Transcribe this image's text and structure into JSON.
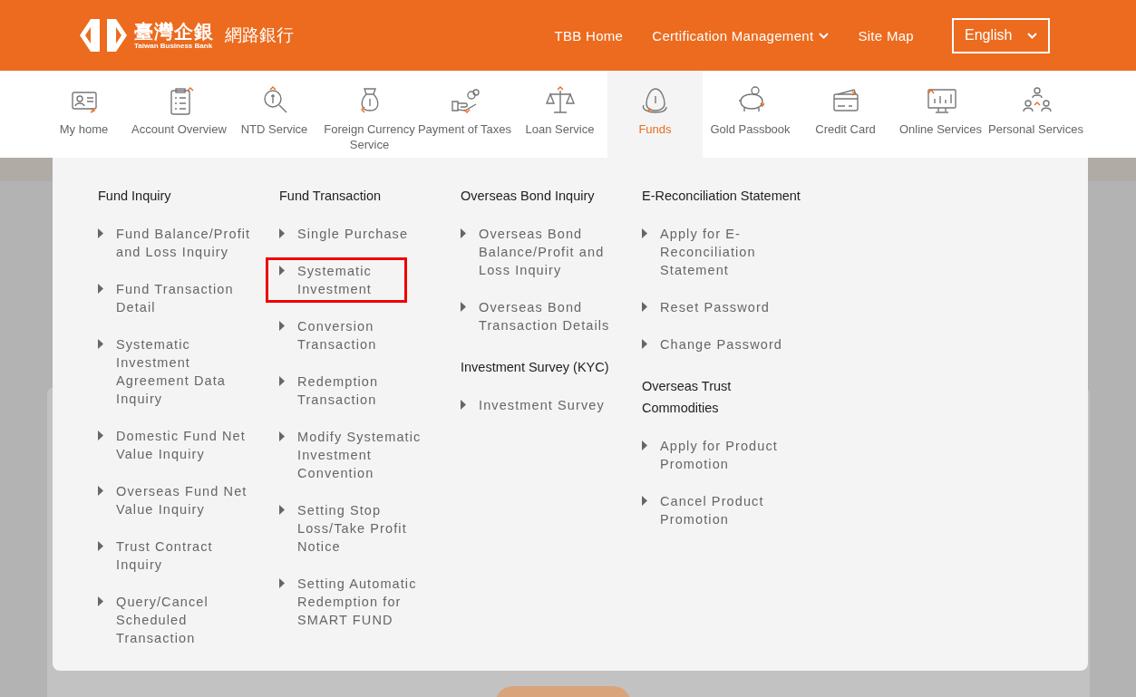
{
  "header": {
    "logo_name": "臺灣企銀",
    "logo_subtitle": "Taiwan Business Bank",
    "site_title": "網路銀行",
    "links": [
      {
        "label": "TBB Home",
        "dropdown": false
      },
      {
        "label": "Certification Management",
        "dropdown": true
      },
      {
        "label": "Site Map",
        "dropdown": false
      }
    ],
    "language": "English"
  },
  "nav": [
    {
      "label": "My home",
      "selected": false
    },
    {
      "label": "Account Overview",
      "selected": false
    },
    {
      "label": "NTD Service",
      "selected": false
    },
    {
      "label": "Foreign Currency Service",
      "selected": false
    },
    {
      "label": "Payment of Taxes",
      "selected": false
    },
    {
      "label": "Loan Service",
      "selected": false
    },
    {
      "label": "Funds",
      "selected": true
    },
    {
      "label": "Gold Passbook",
      "selected": false
    },
    {
      "label": "Credit Card",
      "selected": false
    },
    {
      "label": "Online Services",
      "selected": false
    },
    {
      "label": "Personal Services",
      "selected": false
    }
  ],
  "menu": {
    "columns": [
      {
        "groups": [
          {
            "heading": "Fund Inquiry",
            "items": [
              {
                "label": "Fund Balance/Profit and Loss Inquiry",
                "selected": false
              },
              {
                "label": "Fund Transaction Detail",
                "selected": false
              },
              {
                "label": "Systematic Investment Agreement Data Inquiry",
                "selected": false
              },
              {
                "label": "Domestic Fund Net Value Inquiry",
                "selected": false
              },
              {
                "label": "Overseas Fund Net Value Inquiry",
                "selected": false
              },
              {
                "label": "Trust Contract Inquiry",
                "selected": false
              },
              {
                "label": "Query/Cancel Scheduled Transaction",
                "selected": false
              }
            ]
          }
        ]
      },
      {
        "groups": [
          {
            "heading": "Fund Transaction",
            "items": [
              {
                "label": "Single Purchase",
                "selected": false
              },
              {
                "label": "Systematic Investment",
                "selected": true
              },
              {
                "label": "Conversion Transaction",
                "selected": false
              },
              {
                "label": "Redemption Transaction",
                "selected": false
              },
              {
                "label": "Modify Systematic Investment Convention",
                "selected": false
              },
              {
                "label": "Setting Stop Loss/Take Profit Notice",
                "selected": false
              },
              {
                "label": "Setting Automatic Redemption for SMART FUND",
                "selected": false
              }
            ]
          }
        ]
      },
      {
        "groups": [
          {
            "heading": "Overseas Bond Inquiry",
            "items": [
              {
                "label": "Overseas Bond Balance/Profit and Loss Inquiry",
                "selected": false
              },
              {
                "label": "Overseas Bond Transaction Details",
                "selected": false
              }
            ]
          },
          {
            "heading": "Investment Survey (KYC)",
            "items": [
              {
                "label": "Investment Survey",
                "selected": false
              }
            ]
          }
        ]
      },
      {
        "groups": [
          {
            "heading": "E-Reconciliation Statement",
            "items": [
              {
                "label": "Apply for E-Reconciliation Statement",
                "selected": false
              },
              {
                "label": "Reset Password",
                "selected": false
              },
              {
                "label": "Change Password",
                "selected": false
              }
            ]
          },
          {
            "heading": "Overseas Trust Commodities",
            "items": [
              {
                "label": "Apply for Product Promotion",
                "selected": false
              },
              {
                "label": "Cancel Product Promotion",
                "selected": false
              }
            ]
          }
        ]
      }
    ]
  }
}
